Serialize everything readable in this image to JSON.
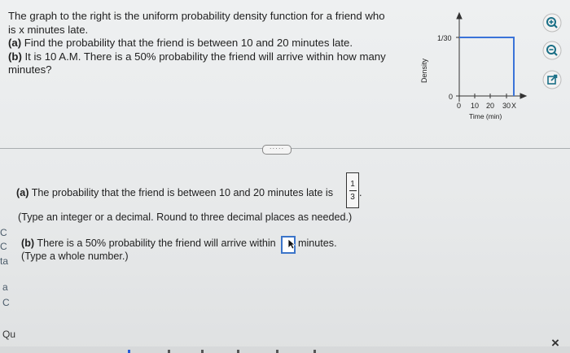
{
  "question": {
    "line1": "The graph to the right is the uniform probability density function for a friend who",
    "line2": "is x minutes late.",
    "a_label": "(a)",
    "a_text": "Find the probability that the friend is between 10 and 20 minutes late.",
    "b_label": "(b)",
    "b_text_1": "It is 10 A.M. There is a 50% probability the friend will arrive within how many",
    "b_text_2": "minutes?"
  },
  "graph": {
    "y_tick_top": "1/30",
    "y_tick_zero": "0",
    "y_label": "Density",
    "x_ticks": [
      "0",
      "10",
      "20",
      "30"
    ],
    "x_var": "X",
    "x_label": "Time (min)",
    "line_color": "#3a73d8"
  },
  "divider_button": "·····",
  "answer_a": {
    "label": "(a)",
    "text": "The probability that the friend is between 10 and 20 minutes late is",
    "numerator": "1",
    "denominator": "3",
    "period": ".",
    "hint": "(Type an integer or a decimal. Round to three decimal places as needed.)"
  },
  "answer_b": {
    "label": "(b)",
    "text_before": "There is a 50% probability the friend will arrive within",
    "text_after": "minutes.",
    "hint": "(Type a whole number.)"
  },
  "left_fragments": [
    "C",
    "C",
    "ta",
    "a",
    "C",
    "Qu"
  ],
  "icons": {
    "zoom_in": "zoom-in-icon",
    "zoom_out": "zoom-out-icon",
    "popout": "popout-icon",
    "close": "×"
  }
}
